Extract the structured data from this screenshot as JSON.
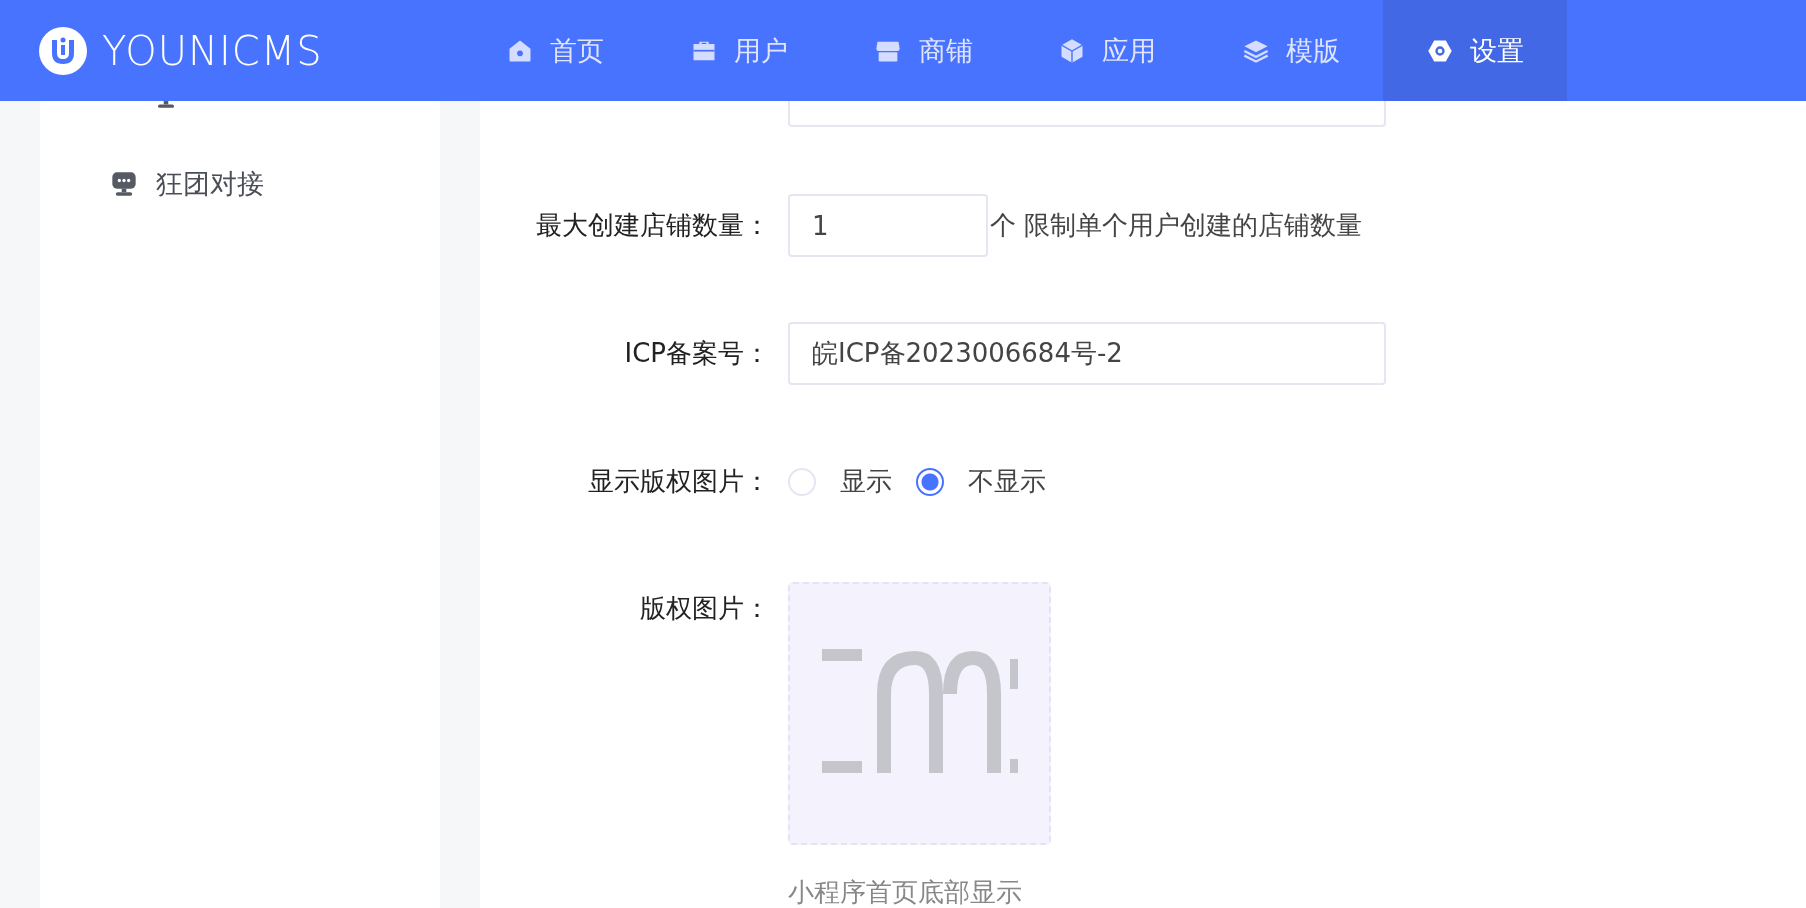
{
  "header": {
    "logo_text": "YOUNICMS",
    "nav": [
      {
        "label": "首页",
        "selected": false
      },
      {
        "label": "用户",
        "selected": false
      },
      {
        "label": "商铺",
        "selected": false
      },
      {
        "label": "应用",
        "selected": false
      },
      {
        "label": "模版",
        "selected": false
      },
      {
        "label": "设置",
        "selected": true
      }
    ]
  },
  "sidebar": {
    "items": [
      {
        "label": "狂团对接"
      }
    ]
  },
  "form": {
    "rows": [
      {
        "kind": "number",
        "label": "最大创建店铺数量：",
        "value": "1",
        "suffix": "个 限制单个用户创建的店铺数量"
      },
      {
        "kind": "input",
        "label": "ICP备案号：",
        "value": "皖ICP备2023006684号-2"
      },
      {
        "kind": "radio",
        "label": "显示版权图片：",
        "options": [
          {
            "label": "显示",
            "selected": false
          },
          {
            "label": "不显示",
            "selected": true
          }
        ]
      },
      {
        "label": "版权图片：",
        "hint": "小程序首页底部显示"
      }
    ]
  }
}
